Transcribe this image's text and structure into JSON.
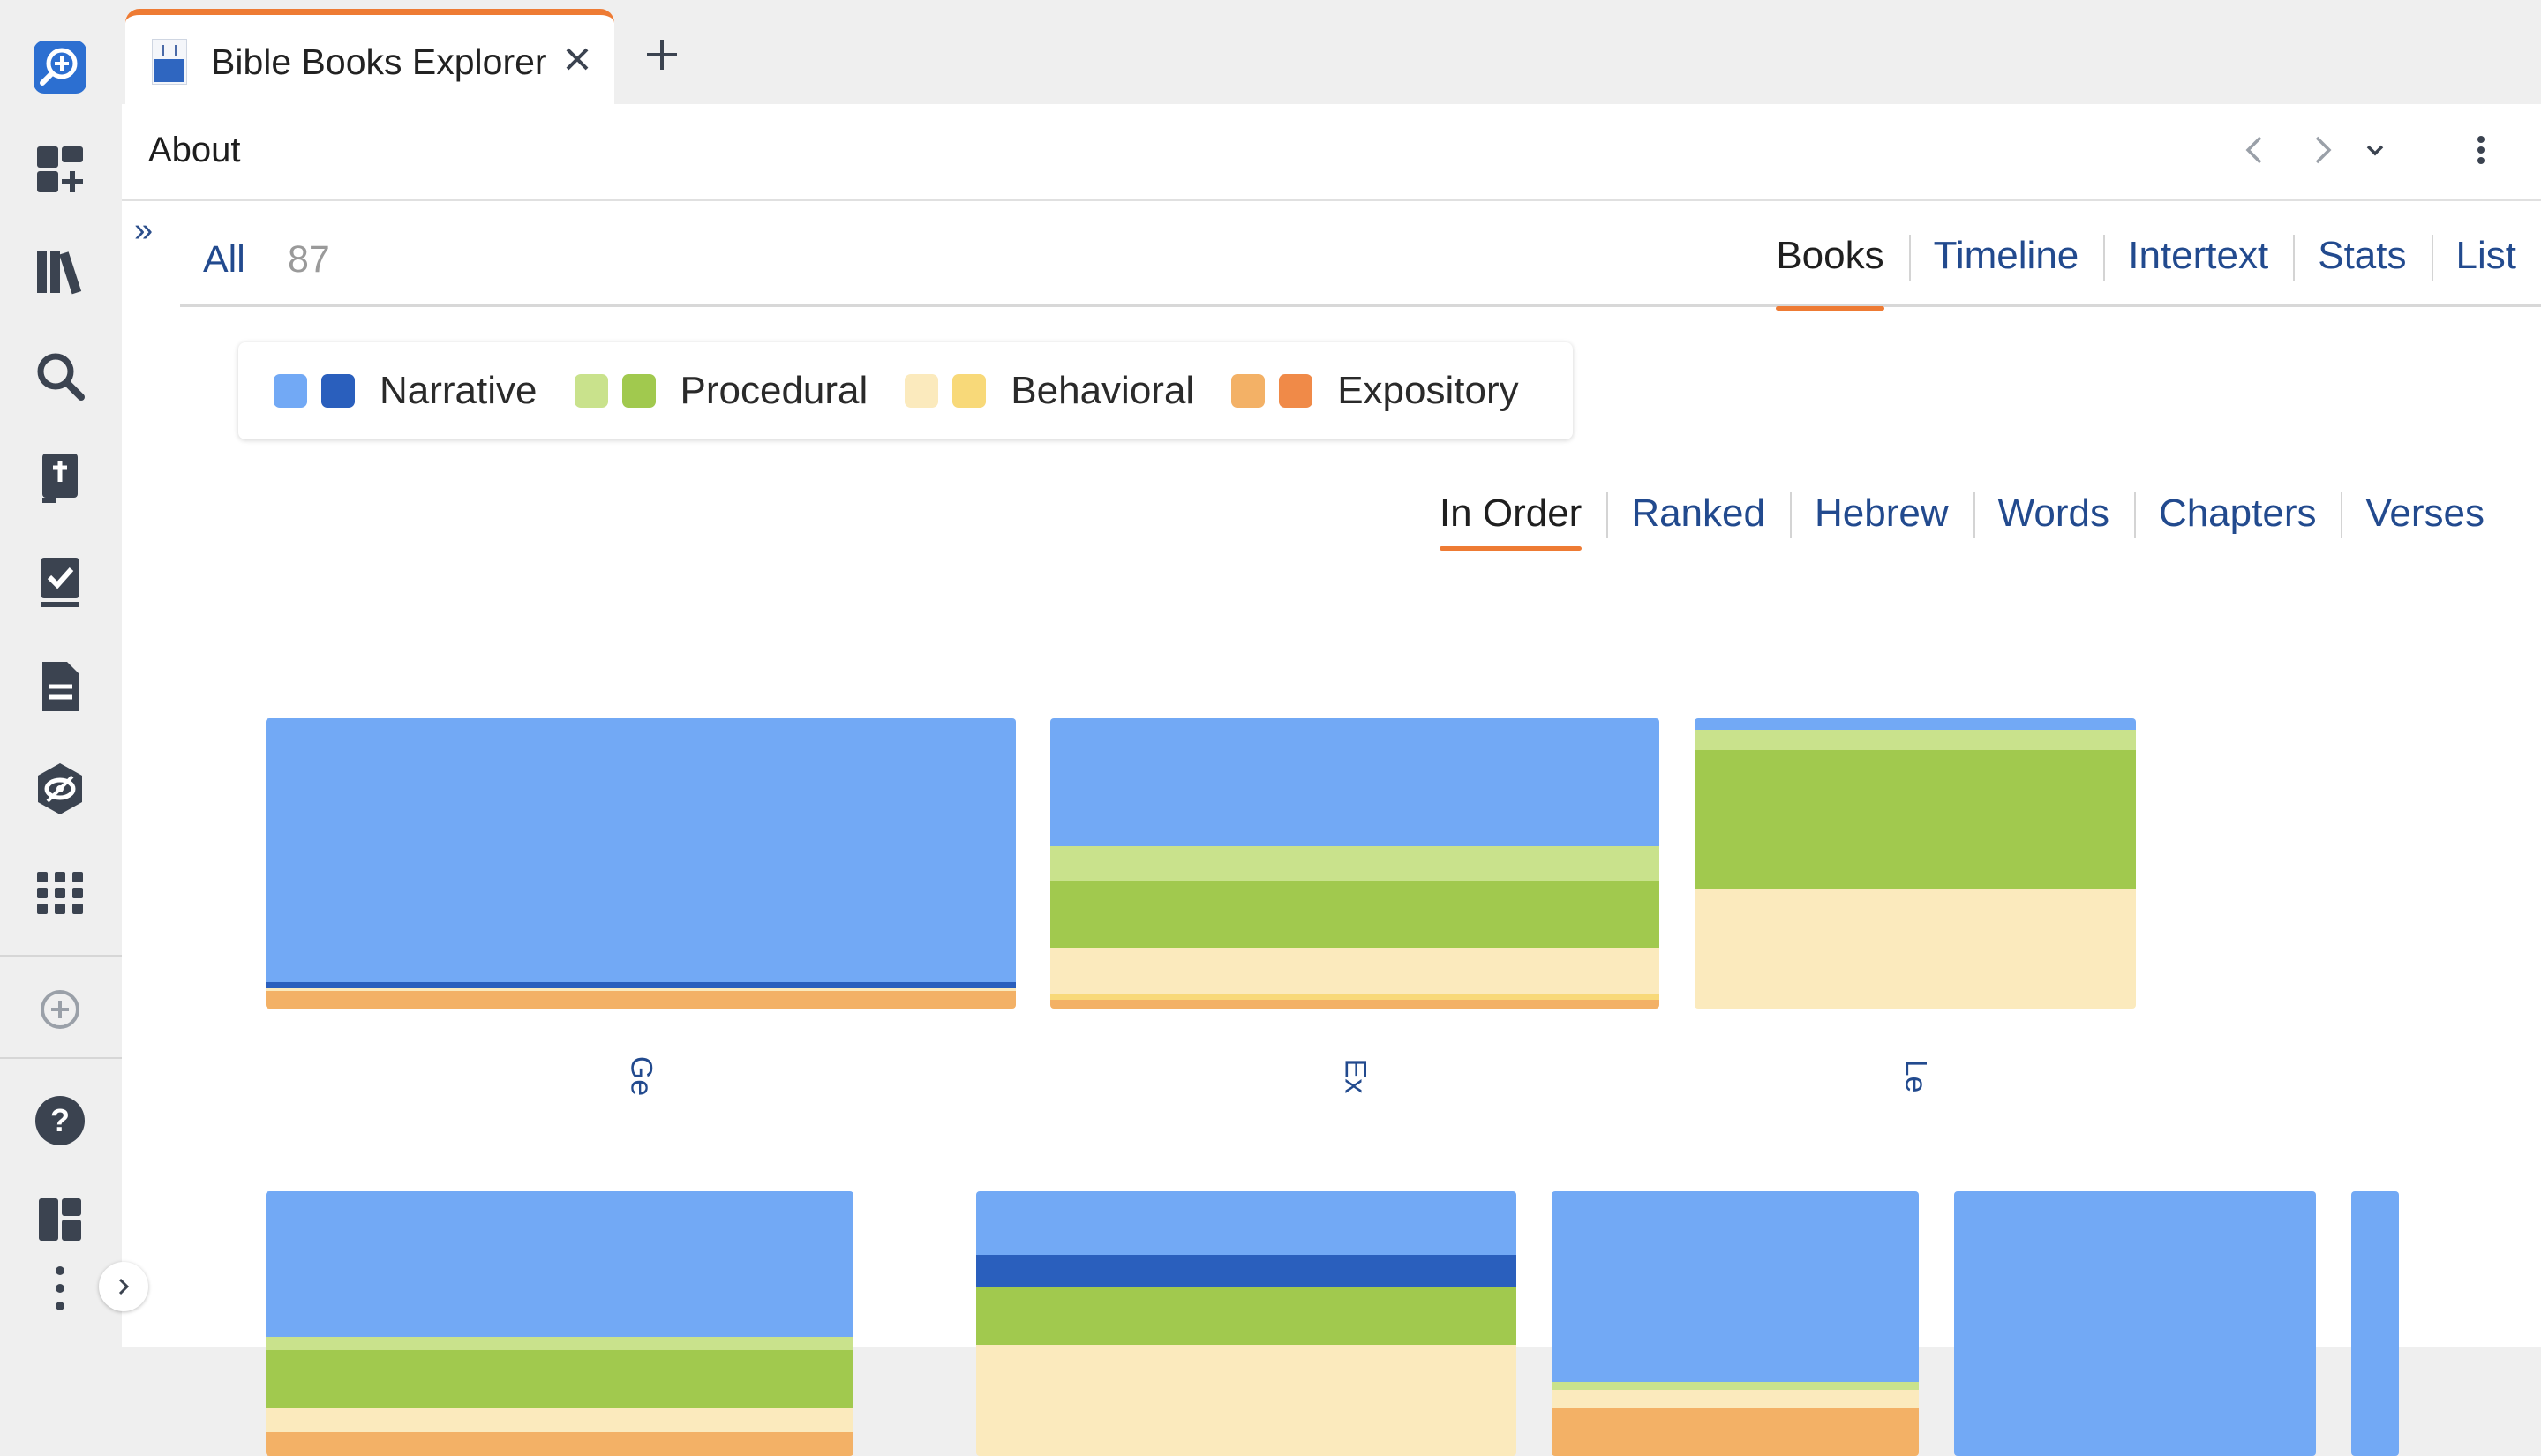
{
  "rail": {
    "icons": [
      "logos-search-icon",
      "add-panel-icon",
      "library-icon",
      "search-icon",
      "bible-icon",
      "reading-plan-icon",
      "document-icon",
      "factbook-icon",
      "apps-grid-icon",
      "add-circle-icon",
      "help-icon",
      "layouts-icon",
      "more-vertical-icon"
    ],
    "toggle_icon": "chevron-right-icon"
  },
  "tab": {
    "title": "Bible Books Explorer",
    "close_icon": "close-icon",
    "add_icon": "plus-icon"
  },
  "panel": {
    "title": "About",
    "nav": [
      "chevron-left-icon",
      "chevron-right-icon",
      "chevron-down-icon",
      "more-vertical-icon"
    ]
  },
  "filter": {
    "expand_label": "»",
    "all_label": "All",
    "count": "87"
  },
  "view_tabs": [
    "Books",
    "Timeline",
    "Intertext",
    "Stats",
    "List"
  ],
  "active_view_tab": "Books",
  "legend": [
    {
      "label": "Narrative",
      "colors": [
        "#72a9f5",
        "#2a5fbd"
      ]
    },
    {
      "label": "Procedural",
      "colors": [
        "#c9e28c",
        "#a1c94e"
      ]
    },
    {
      "label": "Behavioral",
      "colors": [
        "#fbeabd",
        "#f8d979"
      ]
    },
    {
      "label": "Expository",
      "colors": [
        "#f3b166",
        "#f08a48"
      ]
    }
  ],
  "sort_tabs": [
    "In Order",
    "Ranked",
    "Hebrew",
    "Words",
    "Chapters",
    "Verses"
  ],
  "active_sort_tab": "In Order",
  "books": [
    {
      "label": "Ge",
      "segments": [
        {
          "color": "#72a9f5",
          "share": 0.91
        },
        {
          "color": "#2a5fbd",
          "share": 0.02
        },
        {
          "color": "#fbeabd",
          "share": 0.01
        },
        {
          "color": "#f3b166",
          "share": 0.06
        }
      ]
    },
    {
      "label": "Ex",
      "segments": [
        {
          "color": "#72a9f5",
          "share": 0.44
        },
        {
          "color": "#c9e28c",
          "share": 0.12
        },
        {
          "color": "#a1c94e",
          "share": 0.23
        },
        {
          "color": "#fbeabd",
          "share": 0.16
        },
        {
          "color": "#f8d979",
          "share": 0.02
        },
        {
          "color": "#f3b166",
          "share": 0.03
        }
      ]
    },
    {
      "label": "Le",
      "segments": [
        {
          "color": "#72a9f5",
          "share": 0.04
        },
        {
          "color": "#c9e28c",
          "share": 0.07
        },
        {
          "color": "#a1c94e",
          "share": 0.48
        },
        {
          "color": "#fbeabd",
          "share": 0.41
        }
      ]
    },
    {
      "label": "",
      "segments": [
        {
          "color": "#72a9f5",
          "share": 0.55
        },
        {
          "color": "#c9e28c",
          "share": 0.05
        },
        {
          "color": "#a1c94e",
          "share": 0.22
        },
        {
          "color": "#fbeabd",
          "share": 0.09
        },
        {
          "color": "#f3b166",
          "share": 0.09
        }
      ]
    },
    {
      "label": "",
      "segments": [
        {
          "color": "#72a9f5",
          "share": 0.24
        },
        {
          "color": "#2a5fbd",
          "share": 0.12
        },
        {
          "color": "#a1c94e",
          "share": 0.22
        },
        {
          "color": "#fbeabd",
          "share": 0.42
        }
      ]
    },
    {
      "label": "",
      "segments": [
        {
          "color": "#72a9f5",
          "share": 0.72
        },
        {
          "color": "#c9e28c",
          "share": 0.03
        },
        {
          "color": "#fbeabd",
          "share": 0.07
        },
        {
          "color": "#f3b166",
          "share": 0.18
        }
      ]
    },
    {
      "label": "",
      "segments": [
        {
          "color": "#72a9f5",
          "share": 1.0
        }
      ]
    },
    {
      "label": "",
      "segments": [
        {
          "color": "#72a9f5",
          "share": 1.0
        }
      ]
    }
  ]
}
